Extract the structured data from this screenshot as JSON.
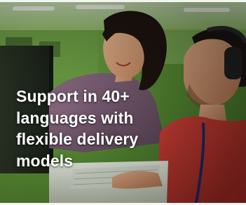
{
  "promo_card": {
    "headline_lines": [
      "Support in 40+",
      "languages with",
      "flexible delivery",
      "models"
    ],
    "image": {
      "subject": "two-agents-at-computer-photo"
    }
  },
  "colors": {
    "headline_text": "#ffffff",
    "office_green": "#5f9a3c",
    "shirt_red": "#c2332e",
    "top_mauve": "#7a5f74"
  }
}
